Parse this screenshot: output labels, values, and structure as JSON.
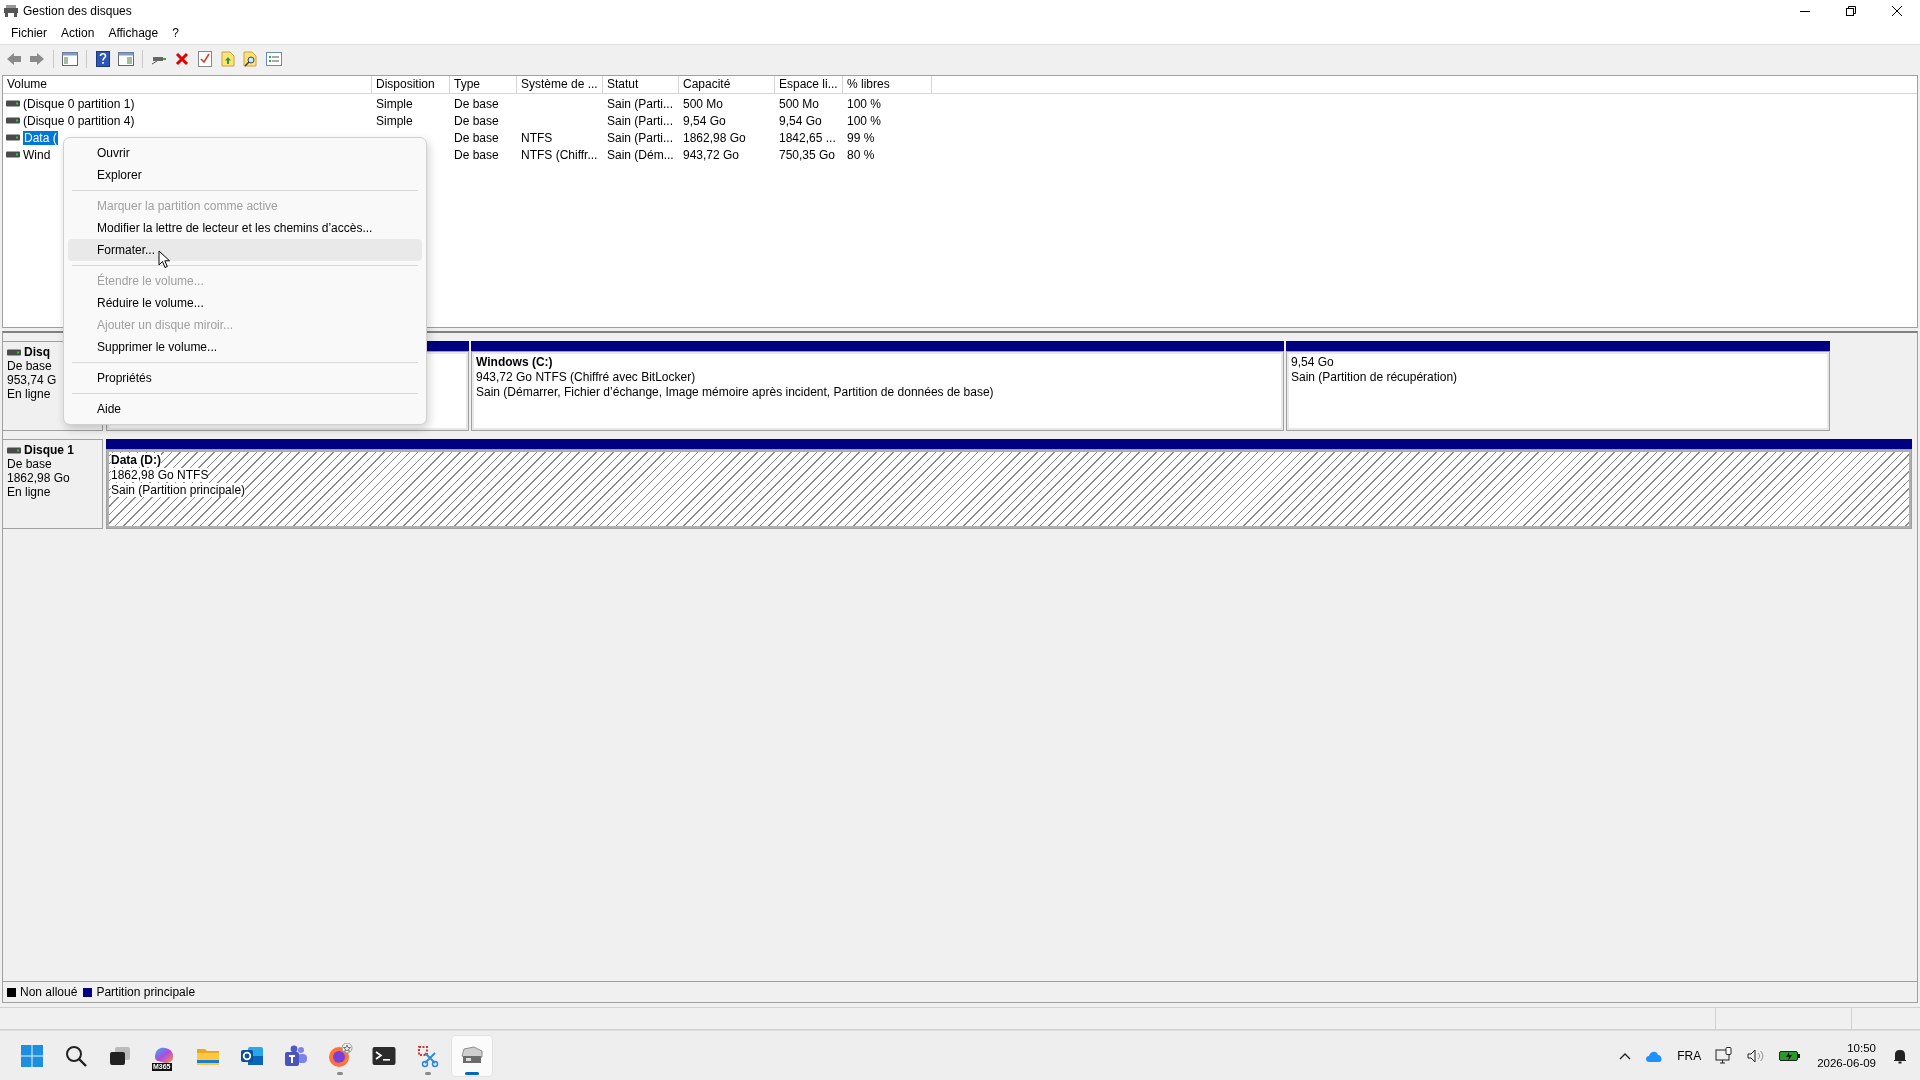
{
  "window": {
    "title": "Gestion des disques"
  },
  "menu_bar": [
    "Fichier",
    "Action",
    "Affichage",
    "?"
  ],
  "volume_table": {
    "columns": [
      "Volume",
      "Disposition",
      "Type",
      "Système de ...",
      "Statut",
      "Capacité",
      "Espace li...",
      "% libres"
    ],
    "rows": [
      {
        "volume": "(Disque 0 partition 1)",
        "layout": "Simple",
        "type": "De base",
        "status": "Sain (Parti...",
        "capacity": "500 Mo",
        "free_space": "500 Mo",
        "percent_free": "100 %",
        "selected": false
      },
      {
        "volume": "(Disque 0 partition 4)",
        "layout": "Simple",
        "type": "De base",
        "status": "Sain (Parti...",
        "capacity": "9,54 Go",
        "free_space": "9,54 Go",
        "percent_free": "100 %",
        "selected": false
      },
      {
        "volume": "Data (",
        "type": "De base",
        "file_system": "NTFS",
        "status": "Sain (Parti...",
        "capacity": "1862,98 Go",
        "free_space": "1842,65 ...",
        "percent_free": "99 %",
        "selected": true
      },
      {
        "volume": "Wind",
        "type": "De base",
        "file_system": "NTFS (Chiffr...",
        "status": "Sain (Dém...",
        "capacity": "943,72 Go",
        "free_space": "750,35 Go",
        "percent_free": "80 %",
        "selected": false
      }
    ]
  },
  "disks": [
    {
      "name": "Disq",
      "type": "De base",
      "size": "953,74 G",
      "status": "En ligne",
      "partitions": [
        {
          "kind": "primary",
          "selected": false
        },
        {
          "kind": "primary",
          "selected": false,
          "title": "Windows  (C:)",
          "size": "943,72 Go NTFS (Chiffré avec BitLocker)",
          "status": "Sain (Démarrer, Fichier d’échange, Image mémoire après incident, Partition de données de base)"
        },
        {
          "kind": "primary",
          "selected": false,
          "size": "9,54 Go",
          "status": "Sain (Partition de récupération)"
        }
      ]
    },
    {
      "name": "Disque 1",
      "type": "De base",
      "size": "1862,98 Go",
      "status": "En ligne",
      "partitions": [
        {
          "kind": "primary",
          "selected": true,
          "title": "Data  (D:)",
          "size": "1862,98 Go NTFS",
          "status": "Sain (Partition principale)"
        }
      ]
    }
  ],
  "legend": [
    {
      "label": "Non alloué",
      "color": "#000000"
    },
    {
      "label": "Partition principale",
      "color": "#000080"
    }
  ],
  "context_menu": [
    {
      "kind": "item",
      "label": "Ouvrir",
      "disabled": false,
      "selected": false
    },
    {
      "kind": "item",
      "label": "Explorer",
      "disabled": false,
      "selected": false
    },
    {
      "kind": "separator"
    },
    {
      "kind": "item",
      "label": "Marquer la partition comme active",
      "disabled": true,
      "selected": false
    },
    {
      "kind": "item",
      "label": "Modifier la lettre de lecteur et les chemins d’accès...",
      "disabled": false,
      "selected": false
    },
    {
      "kind": "item",
      "label": "Formater...",
      "disabled": false,
      "selected": true
    },
    {
      "kind": "separator"
    },
    {
      "kind": "item",
      "label": "Étendre le volume...",
      "disabled": true,
      "selected": false
    },
    {
      "kind": "item",
      "label": "Réduire le volume...",
      "disabled": false,
      "selected": false
    },
    {
      "kind": "item",
      "label": "Ajouter un disque miroir...",
      "disabled": true,
      "selected": false
    },
    {
      "kind": "item",
      "label": "Supprimer le volume...",
      "disabled": false,
      "selected": false
    },
    {
      "kind": "separator"
    },
    {
      "kind": "item",
      "label": "Propriétés",
      "disabled": false,
      "selected": false
    },
    {
      "kind": "separator"
    },
    {
      "kind": "item",
      "label": "Aide",
      "disabled": false,
      "selected": false
    }
  ],
  "taskbar": {
    "apps": [
      {
        "kind": "start",
        "selected": false,
        "running": false
      },
      {
        "kind": "search",
        "selected": false,
        "running": false
      },
      {
        "kind": "task-view",
        "selected": false,
        "running": false
      },
      {
        "kind": "m365",
        "badge": "M365",
        "selected": false,
        "running": false
      },
      {
        "kind": "folder",
        "selected": false,
        "running": false
      },
      {
        "kind": "mail",
        "selected": false,
        "running": false
      },
      {
        "kind": "people",
        "selected": false,
        "running": false
      },
      {
        "kind": "browser",
        "selected": false,
        "running": true
      },
      {
        "kind": "terminal",
        "selected": false,
        "running": false
      },
      {
        "kind": "snip",
        "selected": false,
        "running": true
      },
      {
        "kind": "disk",
        "selected": true,
        "running": true
      }
    ],
    "language": "FRA",
    "time": "10:50",
    "date": "2026-06-09"
  }
}
